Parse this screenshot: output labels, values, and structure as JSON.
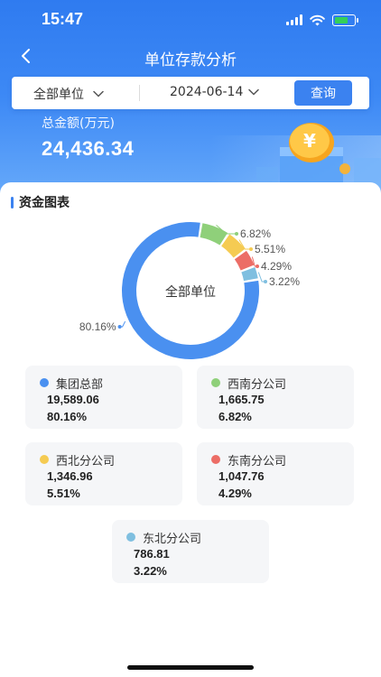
{
  "status_bar": {
    "time": "15:47"
  },
  "navbar": {
    "title": "单位存款分析"
  },
  "filter": {
    "unit_value": "全部单位",
    "date_value": "2024-06-14",
    "query_label": "查询"
  },
  "summary": {
    "total_label": "总金额(万元)",
    "total_value": "24,436.34",
    "illustration_symbol": "¥"
  },
  "section": {
    "title": "资金图表"
  },
  "chart_data": {
    "type": "pie",
    "donut": true,
    "center_label": "全部单位",
    "series": [
      {
        "name": "集团总部",
        "value": 19589.06,
        "amount_text": "19,589.06",
        "percent": 80.16,
        "percent_text": "80.16%",
        "color": "#4a90f0"
      },
      {
        "name": "西南分公司",
        "value": 1665.75,
        "amount_text": "1,665.75",
        "percent": 6.82,
        "percent_text": "6.82%",
        "color": "#8fd07a"
      },
      {
        "name": "西北分公司",
        "value": 1346.96,
        "amount_text": "1,346.96",
        "percent": 5.51,
        "percent_text": "5.51%",
        "color": "#f5cb52"
      },
      {
        "name": "东南分公司",
        "value": 1047.76,
        "amount_text": "1,047.76",
        "percent": 4.29,
        "percent_text": "4.29%",
        "color": "#ec6d66"
      },
      {
        "name": "东北分公司",
        "value": 786.81,
        "amount_text": "786.81",
        "percent": 3.22,
        "percent_text": "3.22%",
        "color": "#7fbfe0"
      }
    ]
  },
  "legend_cards": [
    {
      "name": "集团总部",
      "amount": "19,589.06",
      "percent": "80.16%",
      "color": "#4a90f0"
    },
    {
      "name": "西南分公司",
      "amount": "1,665.75",
      "percent": "6.82%",
      "color": "#8fd07a"
    },
    {
      "name": "西北分公司",
      "amount": "1,346.96",
      "percent": "5.51%",
      "color": "#f5cb52"
    },
    {
      "name": "东南分公司",
      "amount": "1,047.76",
      "percent": "4.29%",
      "color": "#ec6d66"
    },
    {
      "name": "东北分公司",
      "amount": "786.81",
      "percent": "3.22%",
      "color": "#7fbfe0"
    }
  ],
  "icons": {
    "back": "chevron-left-icon",
    "dropdown": "chevron-down-icon",
    "signal": "signal-icon",
    "wifi": "wifi-icon",
    "battery": "battery-icon"
  }
}
